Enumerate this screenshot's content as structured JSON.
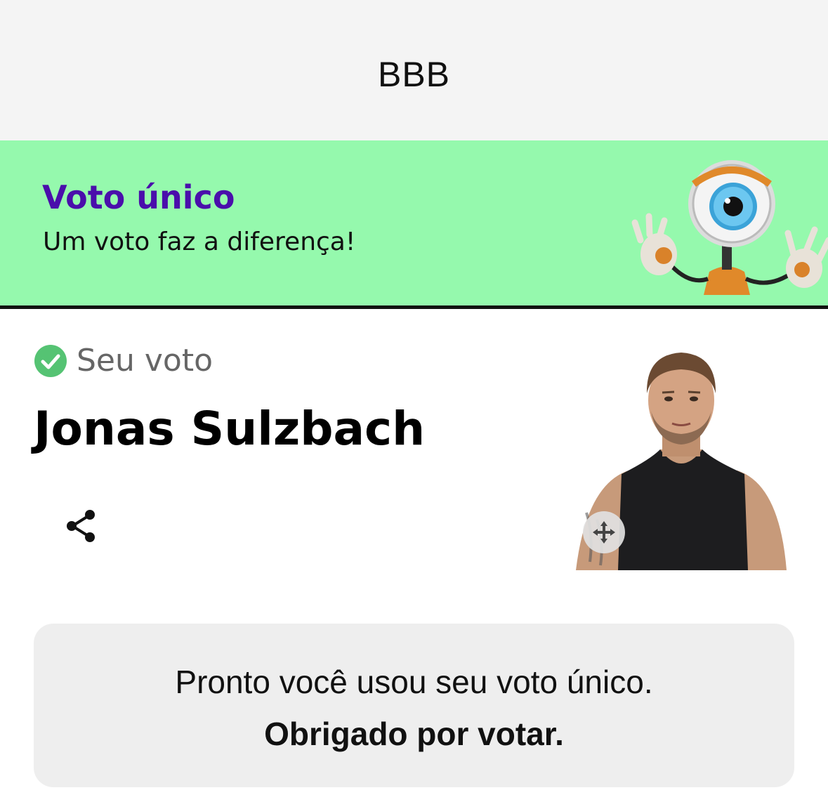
{
  "header": {
    "title": "BBB"
  },
  "banner": {
    "headline": "Voto único",
    "subtitle": "Um voto faz a diferença!",
    "background_color": "#95f9ad",
    "headline_color": "#4a0eab",
    "mascot_icon": "big-brother-eye-robot"
  },
  "vote": {
    "status_icon": "check-circle-icon",
    "status_color": "#55c373",
    "label": "Seu voto",
    "candidate_name": "Jonas Sulzbach",
    "share_icon": "share-icon",
    "move_icon": "move-icon"
  },
  "notice": {
    "line1": "Pronto você usou seu voto único.",
    "line2": "Obrigado por votar."
  }
}
